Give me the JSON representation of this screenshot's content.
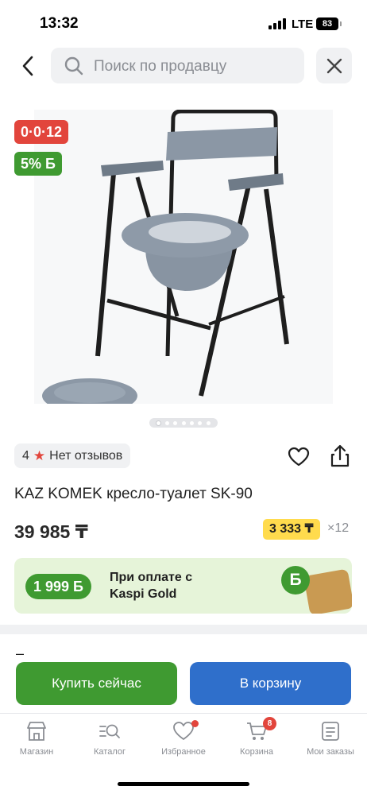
{
  "status_bar": {
    "time": "13:32",
    "network": "LTE",
    "battery": "83"
  },
  "search": {
    "placeholder": "Поиск по продавцу"
  },
  "gallery": {
    "installment_badge": "0·0·12",
    "bonus_badge": "5% Б",
    "slides_total": 7,
    "active_slide": 1
  },
  "rating": {
    "value": "4",
    "reviews_label": "Нет отзывов"
  },
  "product": {
    "title": "KAZ KOMEK кресло-туалет SK-90",
    "price": "39 985 ₸",
    "monthly_payment": "3 333 ₸",
    "installment_months": "×12"
  },
  "kaspi_gold": {
    "bonus": "1 999 Б",
    "line1": "При оплате с",
    "line2": "Kaspi Gold",
    "badge": "Б"
  },
  "section_dash": "–",
  "actions": {
    "buy_now": "Купить сейчас",
    "add_to_cart": "В корзину"
  },
  "tabbar": {
    "items": [
      {
        "label": "Магазин",
        "icon": "store-icon"
      },
      {
        "label": "Каталог",
        "icon": "catalog-icon"
      },
      {
        "label": "Избранное",
        "icon": "heart-icon"
      },
      {
        "label": "Корзина",
        "icon": "cart-icon",
        "badge": "8"
      },
      {
        "label": "Мои заказы",
        "icon": "orders-icon"
      }
    ]
  },
  "colors": {
    "kaspi_red": "#e2453c",
    "kaspi_green": "#3f9a31",
    "cart_blue": "#2f6fcb",
    "installment_yellow": "#ffdb4d"
  }
}
